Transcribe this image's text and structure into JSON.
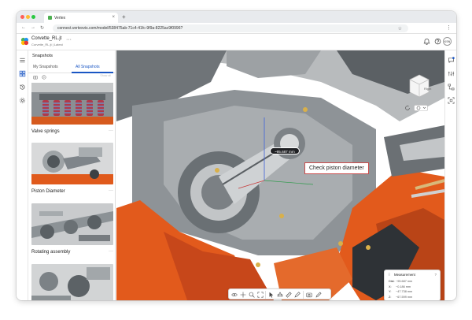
{
  "browser": {
    "tab_title": "Vertex",
    "url": "connect.vertexvis.com/model/538475ab-71c4-41fc-9f9a-8225ac9f0996?"
  },
  "app": {
    "file_name": "Corvette_RL.jt",
    "file_subtitle": "Corvette_RL.jt | Latest",
    "avatar_initials": "KSN"
  },
  "snapshots_panel": {
    "title": "Snapshots",
    "tabs": [
      {
        "label": "My Snapshots",
        "active": false
      },
      {
        "label": "All Snapshots",
        "active": true
      }
    ],
    "toolbar_more": "Show all",
    "items": [
      {
        "label": "Valve springs"
      },
      {
        "label": "Piston Diameter"
      },
      {
        "label": "Rotating assembly"
      },
      {
        "label": ""
      }
    ],
    "item_menu_glyph": "···"
  },
  "viewport": {
    "measurement_pill": "~95.687 mm",
    "callout": "Check piston diameter",
    "view_cube_face": "Right"
  },
  "measurement": {
    "title": "Measurement",
    "rows": [
      {
        "key": "Dist:",
        "value": "~95.687 mm"
      },
      {
        "key": "X:",
        "value": "~0.186 mm"
      },
      {
        "key": "Y:",
        "value": "~47.738 mm"
      },
      {
        "key": "Z:",
        "value": "~67.599 mm"
      }
    ]
  },
  "colors": {
    "accent": "#1a56c4",
    "engine_orange": "#e25a1c",
    "callout_border": "#c94b4b"
  },
  "icons": {
    "left_rail": [
      "menu-icon",
      "snapshots-icon",
      "history-icon",
      "settings-icon"
    ],
    "right_rail": [
      "comments-icon",
      "properties-icon",
      "tree-icon",
      "fit-icon"
    ],
    "toolbar": [
      "orbit-icon",
      "pan-icon",
      "zoom-icon",
      "fit-all-icon",
      "select-icon",
      "measure-icon",
      "section-icon",
      "pmi-icon",
      "markup-icon",
      "camera-icon",
      "pencil-icon"
    ]
  }
}
